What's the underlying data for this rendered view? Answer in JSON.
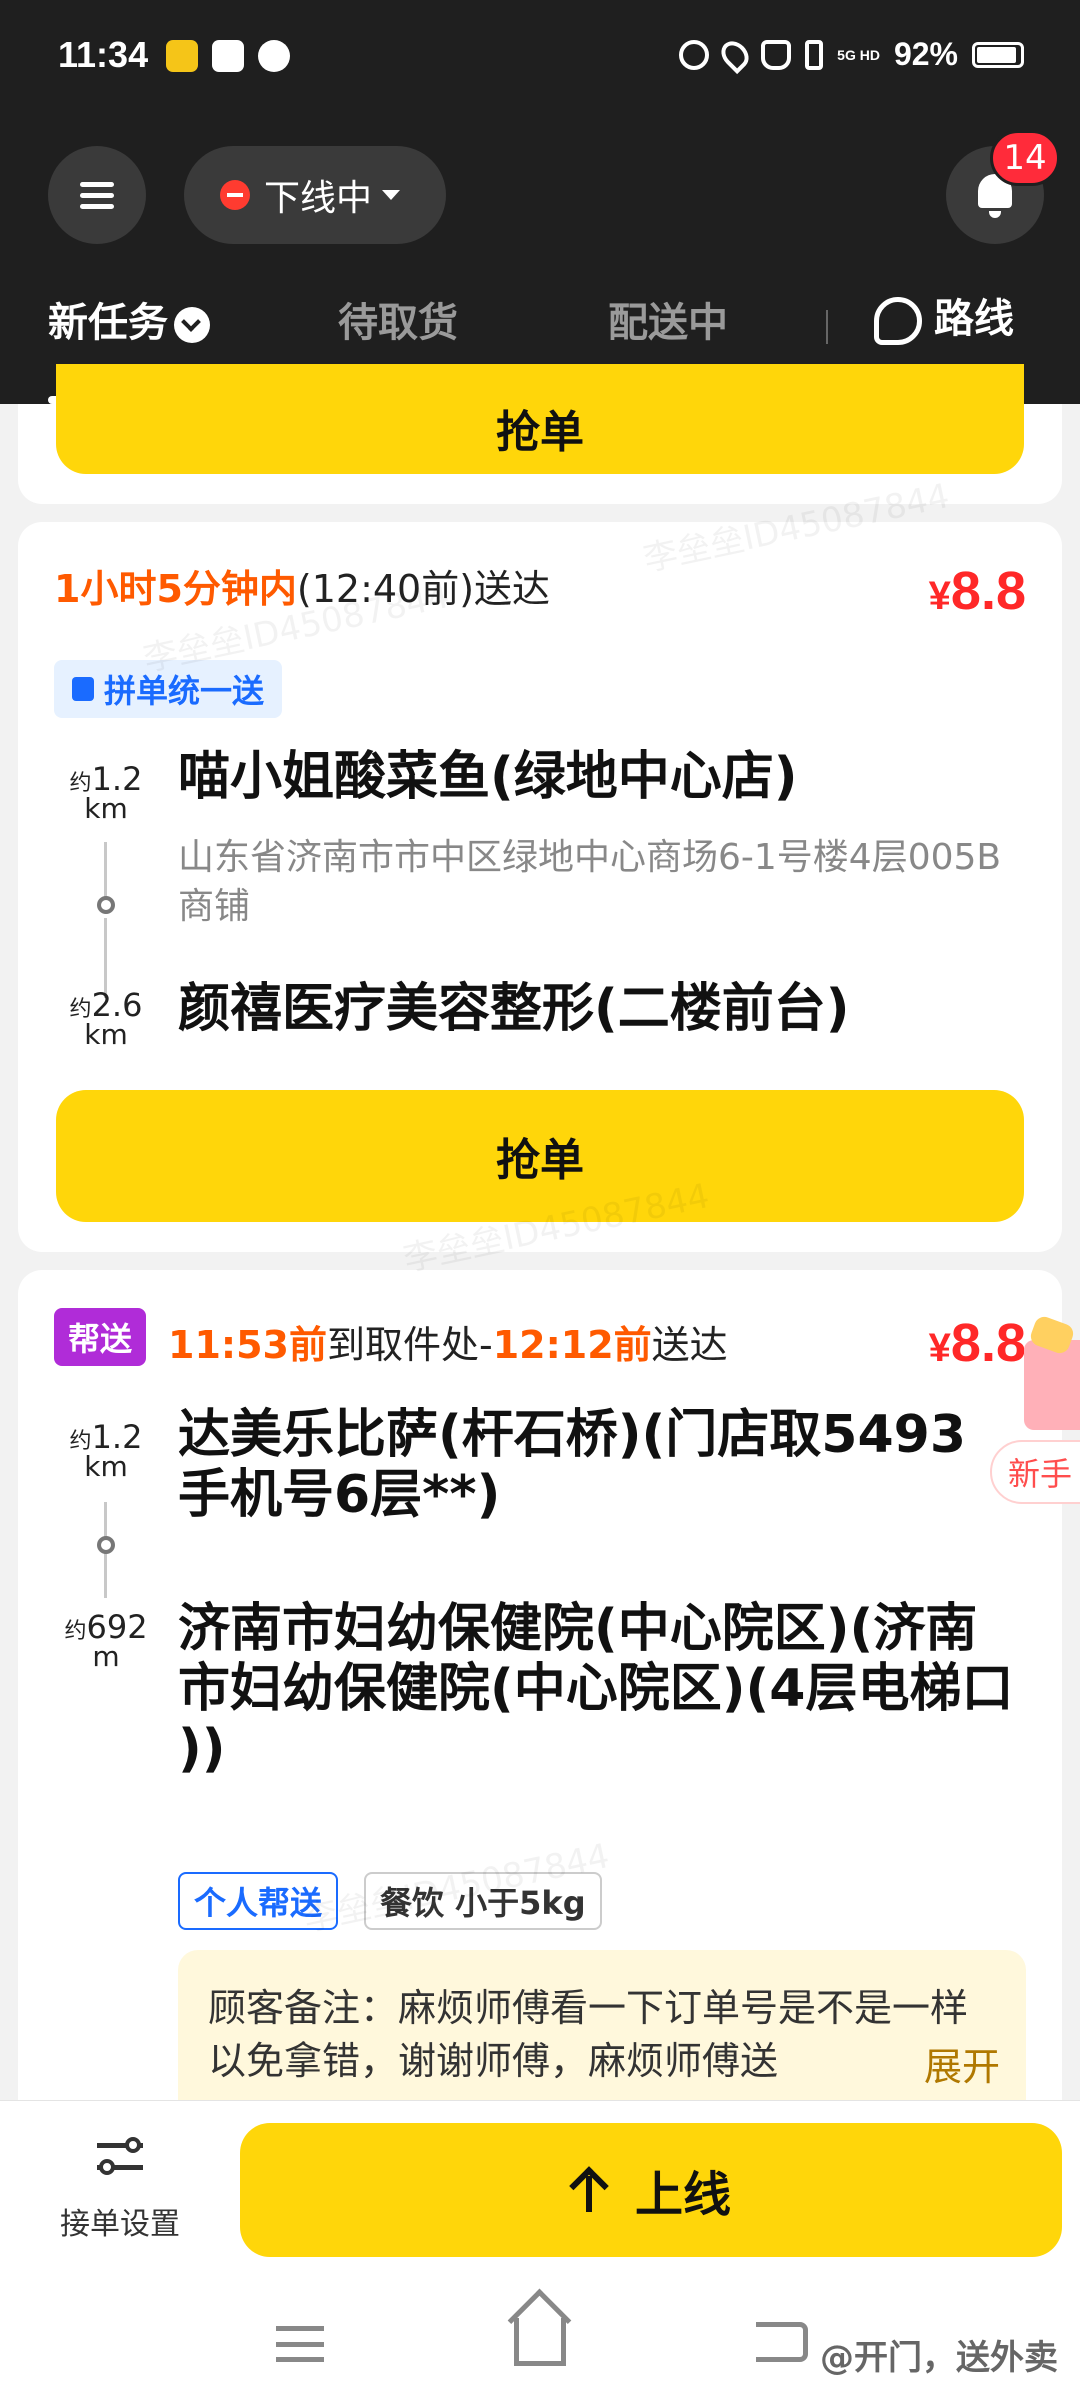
{
  "status_bar": {
    "time": "11:34",
    "network": "5G HD",
    "battery": "92%"
  },
  "header": {
    "status_label": "下线中",
    "notification_count": "14"
  },
  "tabs": [
    {
      "label": "新任务",
      "active": true
    },
    {
      "label": "待取货",
      "active": false
    },
    {
      "label": "配送中",
      "active": false
    },
    {
      "label": "路线",
      "active": false
    }
  ],
  "orders": [
    {
      "grab_label": "抢单"
    },
    {
      "time_highlight": "1小时5分钟内",
      "time_rest": "(12:40前)送达",
      "price_symbol": "¥",
      "price": "8.8",
      "tag": "拼单统一送",
      "pickup": {
        "distance_prefix": "约",
        "distance": "1.2",
        "unit": "km",
        "name": "喵小姐酸菜鱼(绿地中心店)",
        "address": "山东省济南市市中区绿地中心商场6-1号楼4层005B商铺"
      },
      "dropoff": {
        "distance_prefix": "约",
        "distance": "2.6",
        "unit": "km",
        "name": "颜禧医疗美容整形(二楼前台)"
      },
      "grab_label": "抢单"
    },
    {
      "type_tag": "帮送",
      "pick_time": "11:53前",
      "pick_text": "到取件处-",
      "deliver_time": "12:12前",
      "deliver_text": "送达",
      "price_symbol": "¥",
      "price": "8.8",
      "pickup": {
        "distance_prefix": "约",
        "distance": "1.2",
        "unit": "km",
        "name": "达美乐比萨(杆石桥)(门店取5493手机号6层**)"
      },
      "dropoff": {
        "distance_prefix": "约",
        "distance": "692",
        "unit": "m",
        "name": "济南市妇幼保健院(中心院区)(济南市妇幼保健院(中心院区)(4层电梯口 ))"
      },
      "chips": [
        "个人帮送",
        "餐饮 小于5kg"
      ],
      "note": "顾客备注：麻烦师傅看一下订单号是不是一样以免拿错，谢谢师傅，麻烦师傅送",
      "note_expand": "展开"
    }
  ],
  "newbie_label": "新手",
  "bottom": {
    "settings_label": "接单设置",
    "online_label": "上线"
  },
  "watermark_text": "李垒垒ID45087844",
  "corner_watermark": "@开门，送外卖"
}
